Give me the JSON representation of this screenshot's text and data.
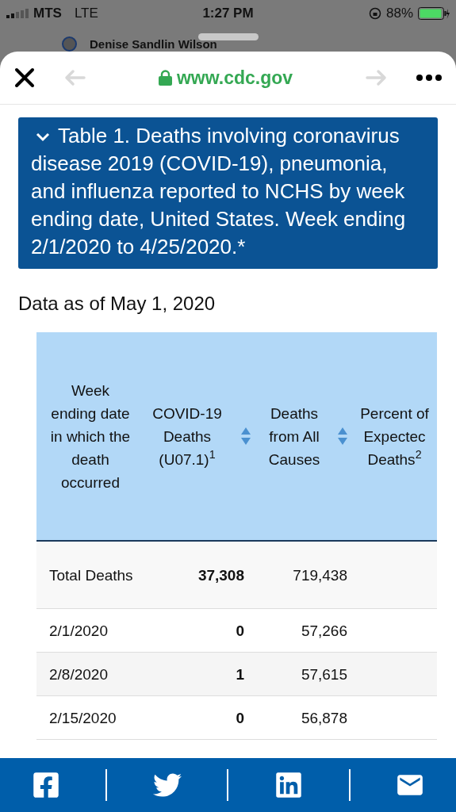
{
  "status_bar": {
    "carrier": "MTS",
    "network": "LTE",
    "time": "1:27 PM",
    "battery": "88%"
  },
  "background_post": {
    "author": "Denise Sandlin Wilson"
  },
  "browser": {
    "url": "www.cdc.gov",
    "back_enabled": false,
    "forward_enabled": false
  },
  "table_caption": {
    "text": "Table 1. Deaths involving coronavirus disease 2019 (COVID-19), pneumonia, and influenza reported to NCHS by week ending date, United States. Week ending 2/1/2020 to 4/25/2020.*",
    "expanded": true
  },
  "data_date": "Data as of May 1, 2020",
  "table": {
    "columns": [
      {
        "label": "Week ending date in which the death occurred",
        "sortable": false
      },
      {
        "label": "COVID-19 Deaths (U07.1)$^{1}$",
        "sortable": true
      },
      {
        "label": "Deaths from All Causes",
        "sortable": true
      },
      {
        "label": "Percent of Expectec Deaths$^{2}$",
        "sortable": false
      }
    ],
    "rows": [
      {
        "date": "Total Deaths",
        "covid": "37,308",
        "all_causes": "719,438"
      },
      {
        "date": "2/1/2020",
        "covid": "0",
        "all_causes": "57,266"
      },
      {
        "date": "2/8/2020",
        "covid": "1",
        "all_causes": "57,615"
      },
      {
        "date": "2/15/2020",
        "covid": "0",
        "all_causes": "56,878"
      }
    ]
  },
  "share_bar": [
    {
      "kind": "facebook"
    },
    {
      "kind": "twitter"
    },
    {
      "kind": "linkedin"
    },
    {
      "kind": "email"
    }
  ]
}
